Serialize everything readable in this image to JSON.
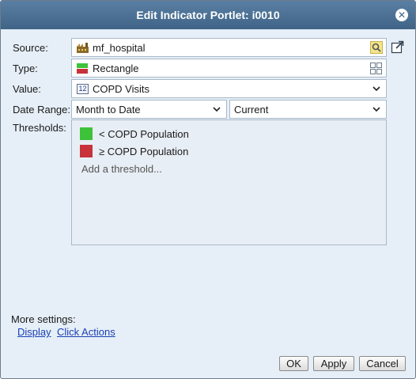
{
  "dialog": {
    "title": "Edit Indicator Portlet: i0010"
  },
  "form": {
    "source_label": "Source:",
    "source_value": "mf_hospital",
    "type_label": "Type:",
    "type_value": "Rectangle",
    "value_label": "Value:",
    "value_value": "COPD Visits",
    "value_icon_text": "12",
    "date_range_label": "Date Range:",
    "date_range_value": "Month to Date",
    "date_period_value": "Current",
    "thresholds_label": "Thresholds:"
  },
  "thresholds": {
    "items": [
      {
        "symbol": "<",
        "text": "< COPD Population",
        "color": "#3ec23a"
      },
      {
        "symbol": "≥",
        "text": "≥ COPD Population",
        "color": "#c8323a"
      }
    ],
    "add_label": "Add a threshold..."
  },
  "more_settings": {
    "label": "More settings:",
    "display_link": "Display",
    "click_actions_link": "Click Actions"
  },
  "buttons": {
    "ok": "OK",
    "apply": "Apply",
    "cancel": "Cancel"
  },
  "colors": {
    "titlebar": "#4a6f94",
    "link": "#1a3fb5",
    "background": "#e6eff7"
  }
}
